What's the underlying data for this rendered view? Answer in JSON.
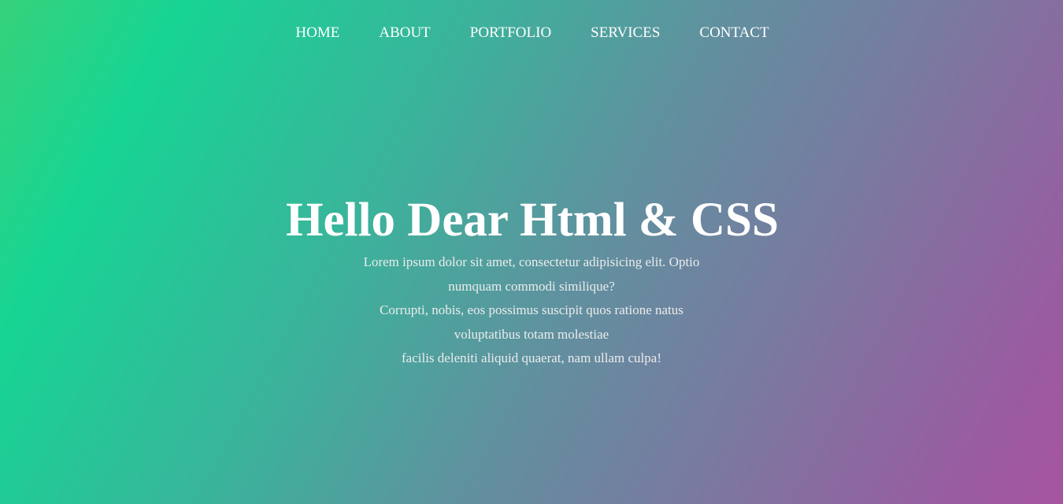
{
  "nav": {
    "items": [
      {
        "label": "HOME"
      },
      {
        "label": "ABOUT"
      },
      {
        "label": "PORTFOLIO"
      },
      {
        "label": "SERVICES"
      },
      {
        "label": "CONTACT"
      }
    ]
  },
  "hero": {
    "title": "Hello Dear Html & CSS",
    "lines": [
      "Lorem ipsum dolor sit amet, consectetur adipisicing elit. Optio",
      "numquam commodi similique?",
      "Corrupti, nobis, eos possimus suscipit quos ratione natus",
      "voluptatibus totam molestiae",
      "facilis deleniti aliquid quaerat, nam ullam culpa!"
    ]
  },
  "colors": {
    "gradient_start": "#36d27a",
    "gradient_green": "#17d494",
    "gradient_mid": "#61909f",
    "gradient_end": "#a655a0",
    "text": "#ffffff"
  }
}
